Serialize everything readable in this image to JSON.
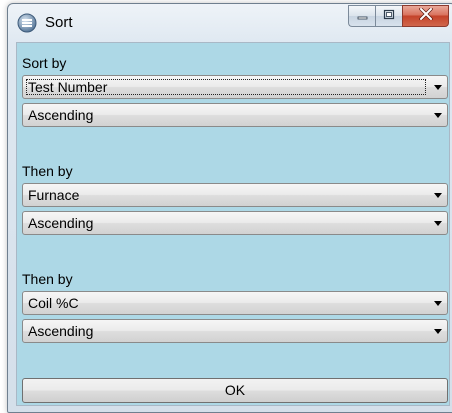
{
  "window": {
    "title": "Sort"
  },
  "sections": [
    {
      "label": "Sort by",
      "field": "Test Number",
      "order": "Ascending"
    },
    {
      "label": "Then by",
      "field": "Furnace",
      "order": "Ascending"
    },
    {
      "label": "Then by",
      "field": "Coil %C",
      "order": "Ascending"
    }
  ],
  "ok_label": "OK",
  "colors": {
    "client_background": "#add8e6",
    "close_button": "#c4432a"
  },
  "icons": {
    "app": "app-icon",
    "minimize": "minimize-icon",
    "maximize": "maximize-icon",
    "close": "close-icon",
    "dropdown": "chevron-down-icon"
  }
}
